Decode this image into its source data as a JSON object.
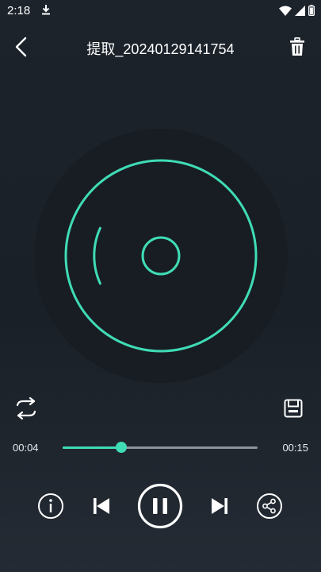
{
  "status_bar": {
    "time": "2:18",
    "icons": [
      "download-icon",
      "wifi-icon",
      "signal-icon",
      "battery-icon"
    ]
  },
  "app_bar": {
    "title": "提取_20240129141754",
    "back_icon": "chevron-left-icon",
    "delete_icon": "trash-icon"
  },
  "player": {
    "current_time": "00:04",
    "total_time": "00:15",
    "progress": 0.3,
    "accent_color": "#3fdcb6",
    "disc_color": "#1a1f25"
  },
  "controls": [
    "info-icon",
    "previous-icon",
    "pause-icon",
    "next-icon",
    "share-icon"
  ],
  "side_buttons": [
    "loop-icon",
    "save-icon"
  ]
}
